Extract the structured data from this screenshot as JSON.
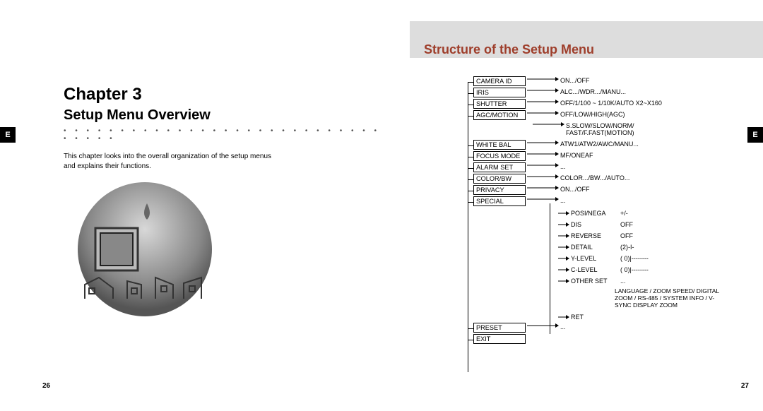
{
  "side_tab": "E",
  "left": {
    "chapter": "Chapter 3",
    "subtitle": "Setup Menu Overview",
    "intro": "This chapter looks into the overall organization of the setup menus and explains their functions.",
    "page_num": "26"
  },
  "right": {
    "title": "Structure of the Setup Menu",
    "page_num": "27",
    "menu": {
      "items": [
        {
          "label": "CAMERA ID",
          "opt": "ON.../OFF"
        },
        {
          "label": "IRIS",
          "opt": "ALC.../WDR.../MANU..."
        },
        {
          "label": "SHUTTER",
          "opt": "OFF/1/100 ~ 1/10K/AUTO X2~X160"
        },
        {
          "label": "AGC/MOTION",
          "opt": "OFF/LOW/HIGH(AGC)",
          "opt2": "S.SLOW/SLOW/NORM/\nFAST/F.FAST(MOTION)"
        },
        {
          "label": "WHITE BAL",
          "opt": "ATW1/ATW2/AWC/MANU..."
        },
        {
          "label": "FOCUS MODE",
          "opt": "MF/ONEAF"
        },
        {
          "label": "ALARM SET",
          "opt": "..."
        },
        {
          "label": "COLOR/BW",
          "opt": "COLOR.../BW.../AUTO..."
        },
        {
          "label": "PRIVACY",
          "opt": "ON.../OFF"
        },
        {
          "label": "SPECIAL",
          "opt": "..."
        }
      ],
      "special_sub": [
        {
          "label": "POSI/NEGA",
          "val": "+/-"
        },
        {
          "label": "DIS",
          "val": "OFF"
        },
        {
          "label": "REVERSE",
          "val": "OFF"
        },
        {
          "label": "DETAIL",
          "val": "(2)-I-"
        },
        {
          "label": "Y-LEVEL",
          "val": "( 0)|--------"
        },
        {
          "label": "C-LEVEL",
          "val": "( 0)|--------"
        },
        {
          "label": "OTHER SET",
          "val": "..."
        }
      ],
      "other_set_note": "LANGUAGE / ZOOM SPEED/\nDIGITAL ZOOM / RS-485 /\nSYSTEM INFO / V-SYNC\nDISPLAY ZOOM",
      "ret": "RET",
      "tail": [
        {
          "label": "PRESET",
          "opt": "..."
        },
        {
          "label": "EXIT"
        }
      ]
    }
  }
}
